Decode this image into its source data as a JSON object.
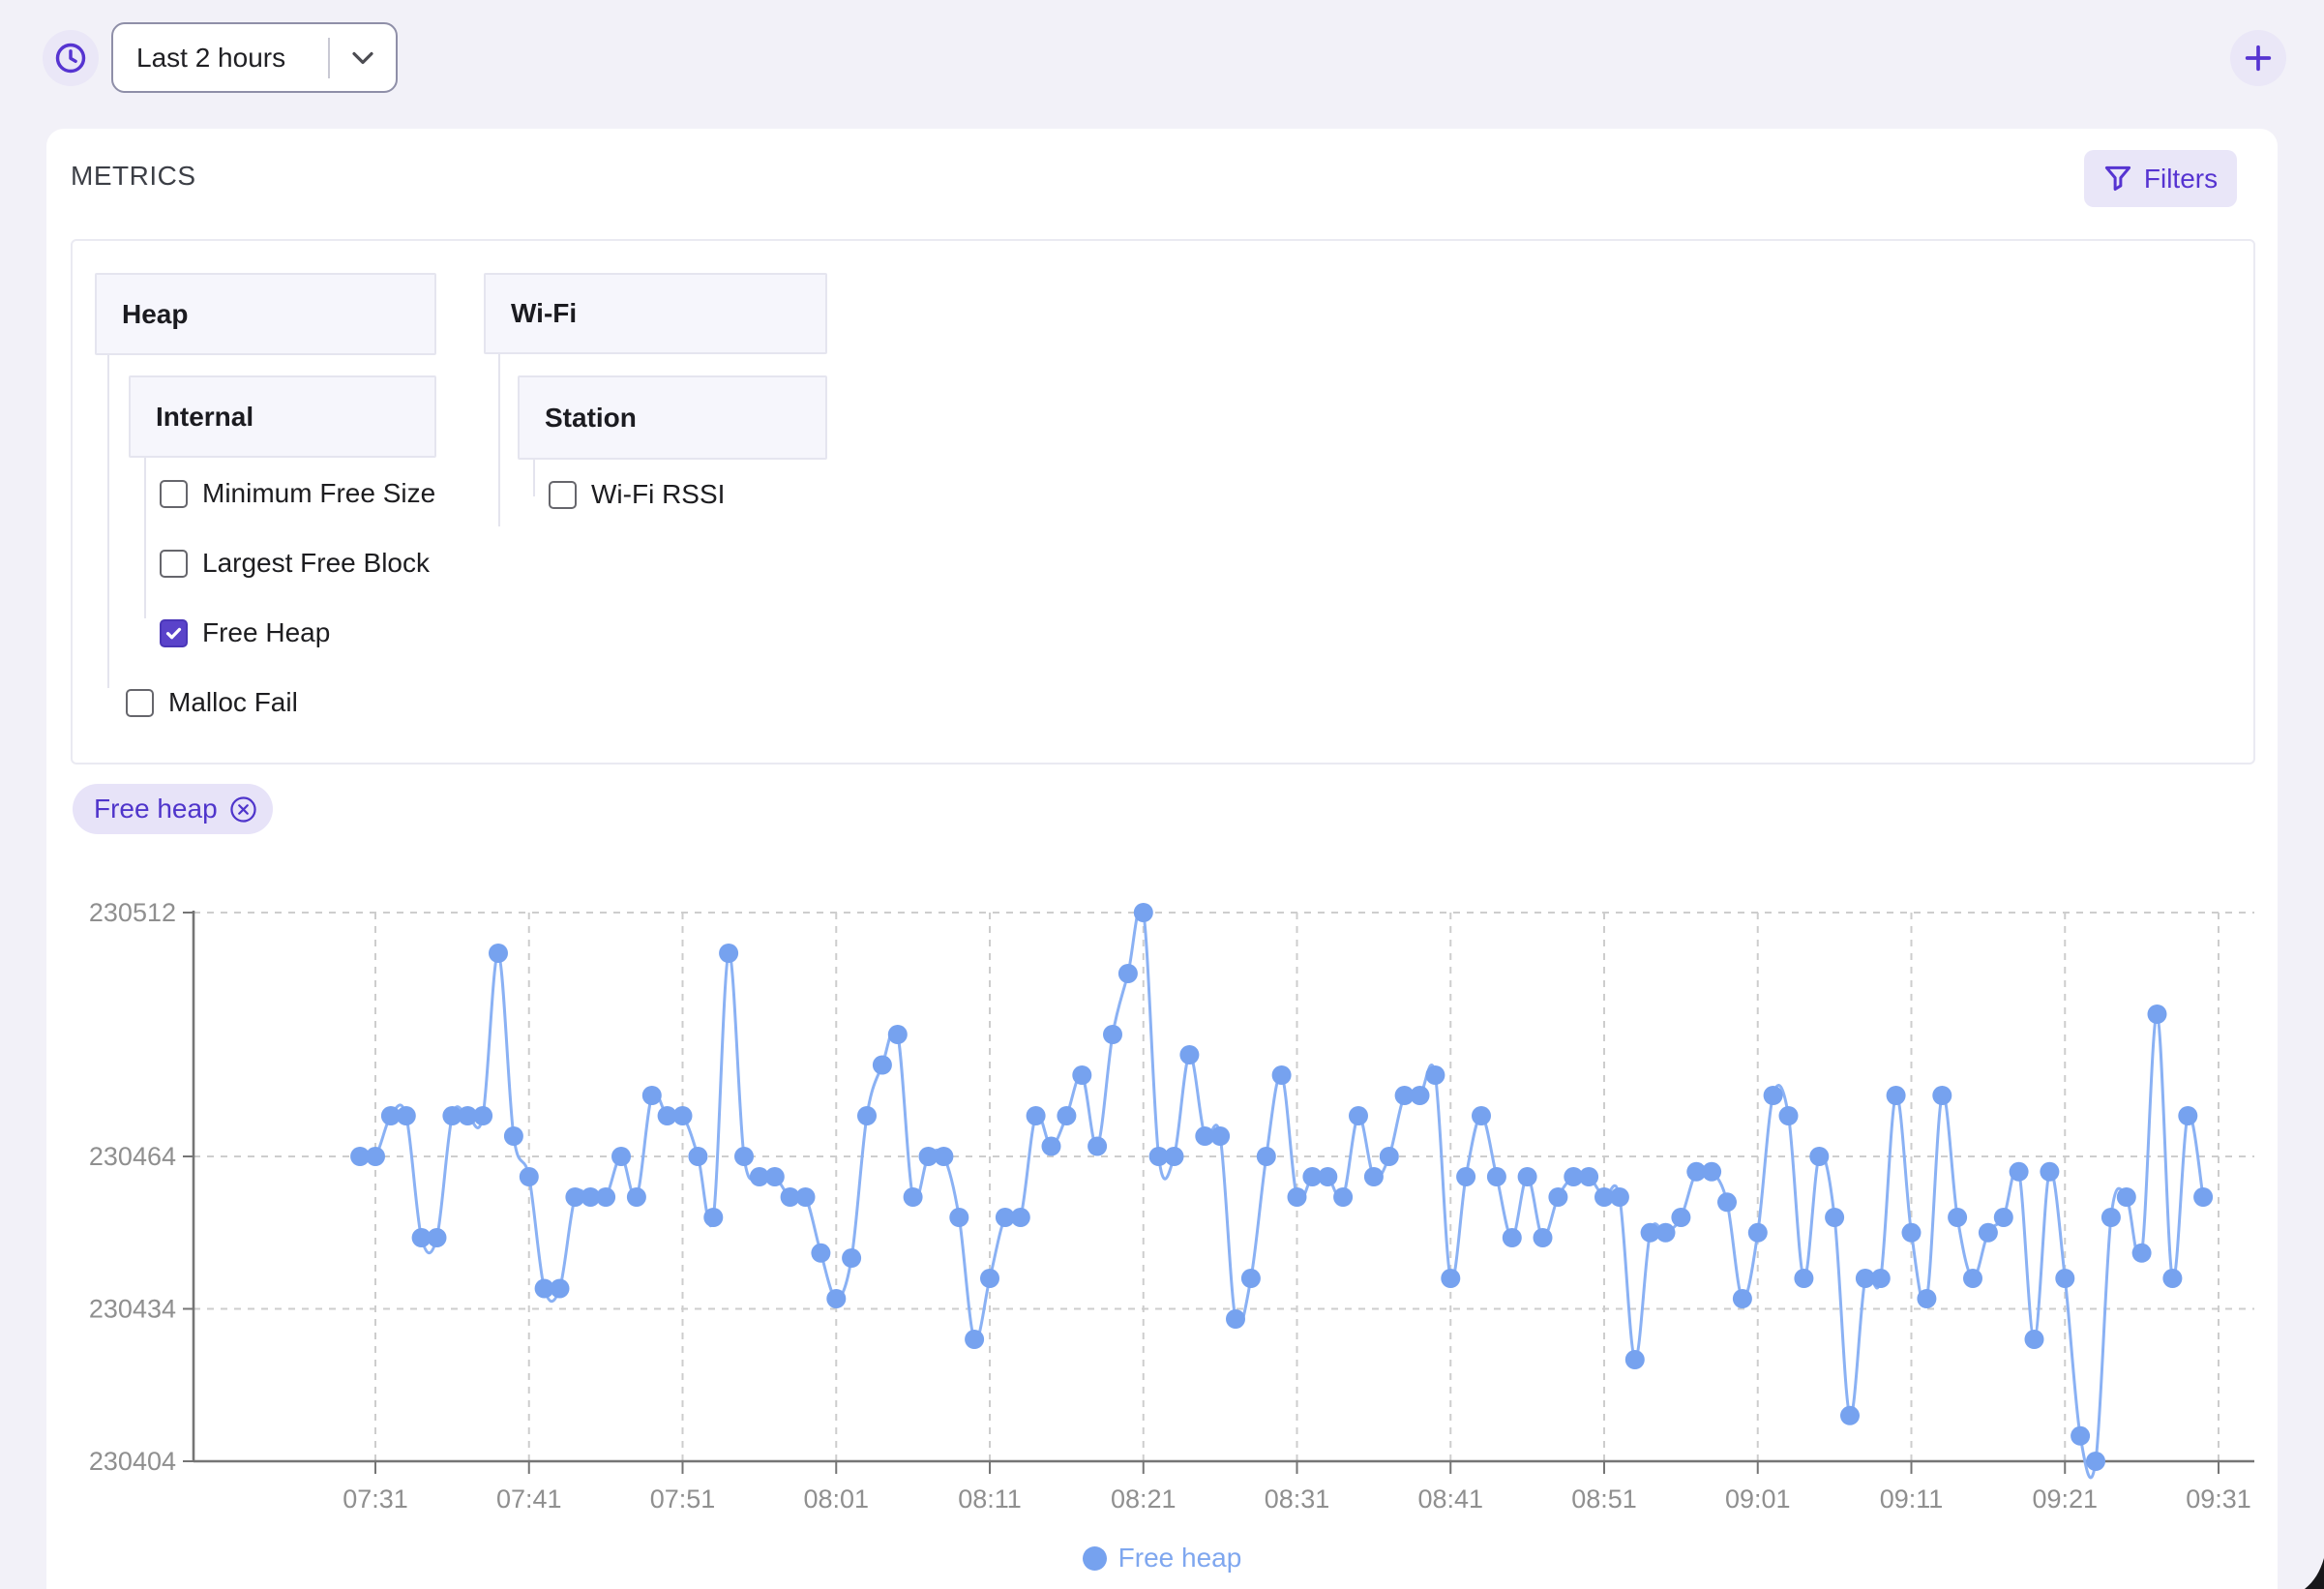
{
  "page": {
    "background_color": "#f2f1f8",
    "accent_color": "#5634d1",
    "series_color": "#76a2ef"
  },
  "toolbar": {
    "time_range_label": "Last 2 hours",
    "icons": {
      "clock": "clock-icon",
      "dropdown_chevron": "chevron-down-icon",
      "add": "plus-icon"
    }
  },
  "metrics_panel": {
    "title": "METRICS",
    "filters_label": "Filters",
    "filter_icon": "funnel-icon",
    "tree": {
      "heap": {
        "label": "Heap"
      },
      "internal": {
        "label": "Internal"
      },
      "wifi": {
        "label": "Wi-Fi"
      },
      "station": {
        "label": "Station"
      },
      "minimum_free_size": {
        "label": "Minimum Free Size",
        "checked": false
      },
      "largest_free_block": {
        "label": "Largest Free Block",
        "checked": false
      },
      "free_heap": {
        "label": "Free Heap",
        "checked": true
      },
      "malloc_fail": {
        "label": "Malloc Fail",
        "checked": false
      },
      "wifi_rssi": {
        "label": "Wi-Fi RSSI",
        "checked": false
      }
    },
    "selected_chip": {
      "label": "Free heap",
      "close_icon": "circled-x-icon"
    }
  },
  "chart_data": {
    "type": "line",
    "title": "",
    "xlabel": "",
    "ylabel": "",
    "grid": "dashed",
    "ylim": [
      230404,
      230512
    ],
    "y_ticks": [
      230512,
      230464,
      230434,
      230404
    ],
    "x_ticks": [
      "07:31",
      "07:41",
      "07:51",
      "08:01",
      "08:11",
      "08:21",
      "08:31",
      "08:41",
      "08:51",
      "09:01",
      "09:11",
      "09:21",
      "09:31"
    ],
    "legend": {
      "position": "bottom",
      "entries": [
        "Free heap"
      ]
    },
    "series": [
      {
        "name": "Free heap",
        "marker_color": "#76a2ef",
        "line_color": "#8ab1f4",
        "x_start": "07:30",
        "x_interval_minutes": 1,
        "values": [
          230464,
          230464,
          230472,
          230472,
          230448,
          230448,
          230472,
          230472,
          230472,
          230504,
          230468,
          230460,
          230438,
          230438,
          230456,
          230456,
          230456,
          230464,
          230456,
          230476,
          230472,
          230472,
          230464,
          230452,
          230504,
          230464,
          230460,
          230460,
          230456,
          230456,
          230445,
          230436,
          230444,
          230472,
          230482,
          230488,
          230456,
          230464,
          230464,
          230452,
          230428,
          230440,
          230452,
          230452,
          230472,
          230466,
          230472,
          230480,
          230466,
          230488,
          230500,
          230512,
          230464,
          230464,
          230484,
          230468,
          230468,
          230432,
          230440,
          230464,
          230480,
          230456,
          230460,
          230460,
          230456,
          230472,
          230460,
          230464,
          230476,
          230476,
          230480,
          230440,
          230460,
          230472,
          230460,
          230448,
          230460,
          230448,
          230456,
          230460,
          230460,
          230456,
          230456,
          230424,
          230449,
          230449,
          230452,
          230461,
          230461,
          230455,
          230436,
          230449,
          230476,
          230472,
          230440,
          230464,
          230452,
          230413,
          230440,
          230440,
          230476,
          230449,
          230436,
          230476,
          230452,
          230440,
          230449,
          230452,
          230461,
          230428,
          230461,
          230440,
          230409,
          230404,
          230452,
          230456,
          230445,
          230492,
          230440,
          230472,
          230456
        ]
      }
    ]
  }
}
